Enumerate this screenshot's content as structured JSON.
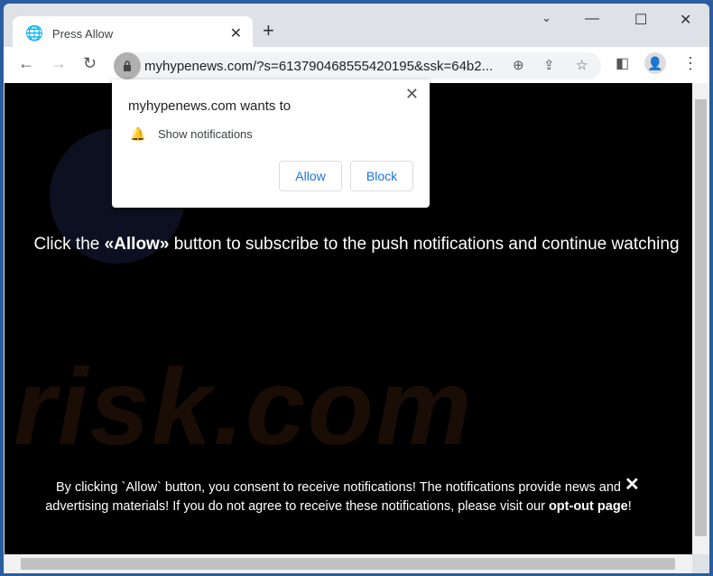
{
  "tab": {
    "title": "Press Allow",
    "icon": "globe-icon"
  },
  "address_bar": {
    "url": "myhypenews.com/?s=613790468555420195&ssk=64b2..."
  },
  "popup": {
    "title": "myhypenews.com wants to",
    "permission": "Show notifications",
    "allow_label": "Allow",
    "block_label": "Block"
  },
  "page": {
    "headline_pre": "Click the ",
    "headline_bold": "«Allow»",
    "headline_post": " button to subscribe to the push notifications and continue watching",
    "consent_text": "By clicking `Allow` button, you consent to receive notifications! The notifications provide news and advertising materials! If you do not agree to receive these notifications, please visit our ",
    "optout_link": "opt-out page",
    "consent_end": "!",
    "watermark": "risk.com"
  },
  "colors": {
    "window_frame": "#2a5d9f",
    "accent": "#1a73e8",
    "content_bg": "#000000"
  }
}
